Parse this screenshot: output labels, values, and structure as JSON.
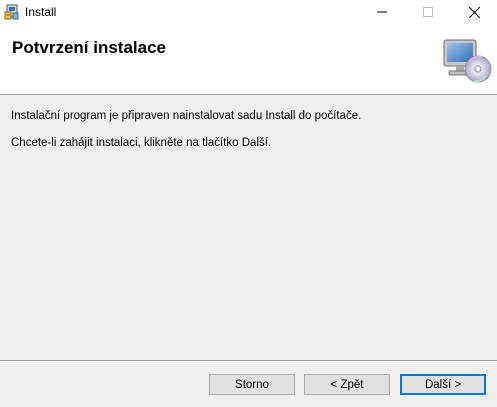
{
  "window": {
    "title": "Install",
    "icon": "installer-icon",
    "controls": [
      "minimize",
      "maximize",
      "close"
    ]
  },
  "header": {
    "title": "Potvrzení instalace",
    "icon": "computer-cd-icon"
  },
  "content": {
    "line1": "Instalační program je připraven nainstalovat sadu Install do počítače.",
    "line2": "Chcete-li zahájit instalaci, klikněte na tlačítko Další."
  },
  "buttons": {
    "cancel": "Storno",
    "back": "< Zpět",
    "next": "Další >"
  },
  "colors": {
    "accent": "#0078d7",
    "background": "#f0f0f0",
    "header_bg": "#ffffff"
  }
}
